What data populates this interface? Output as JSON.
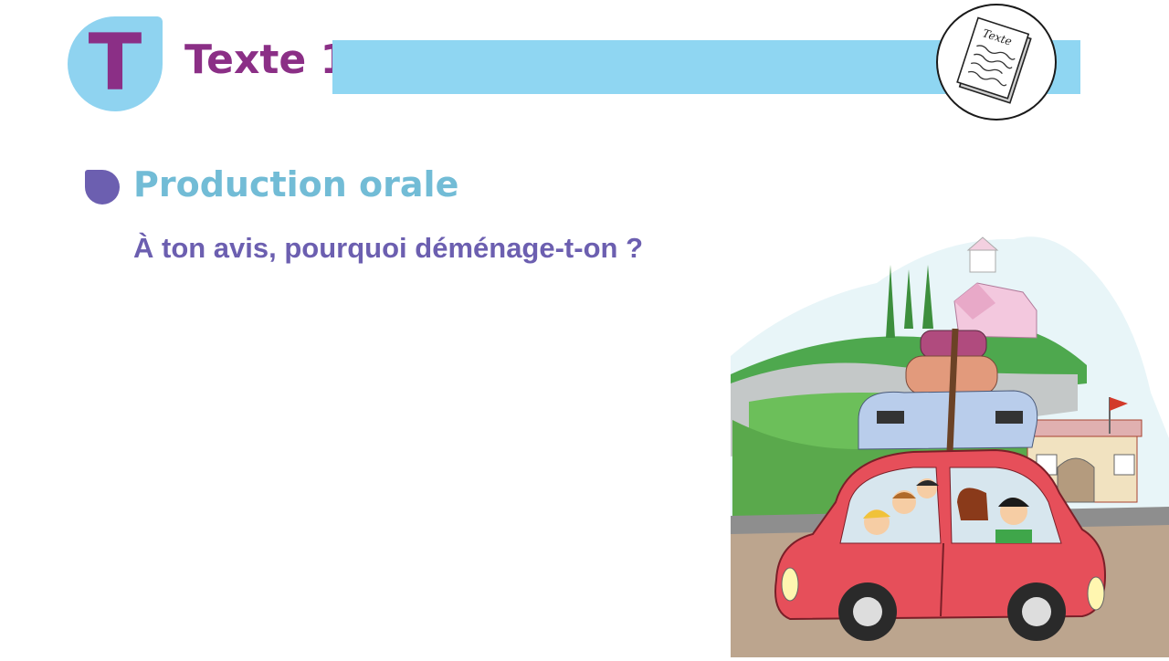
{
  "header": {
    "badge_letter": "T",
    "title": "Texte 1",
    "doc_icon_label": "Texte"
  },
  "main": {
    "heading": "Production orale",
    "question": "À ton avis, pourquoi déménage-t-on ?"
  },
  "colors": {
    "purple": "#8b2f86",
    "light_blue": "#8fd6f2",
    "heading_blue": "#72bcd6",
    "indigo": "#6c5fb0"
  },
  "illustration": {
    "subject": "family-car-moving-illustration"
  }
}
